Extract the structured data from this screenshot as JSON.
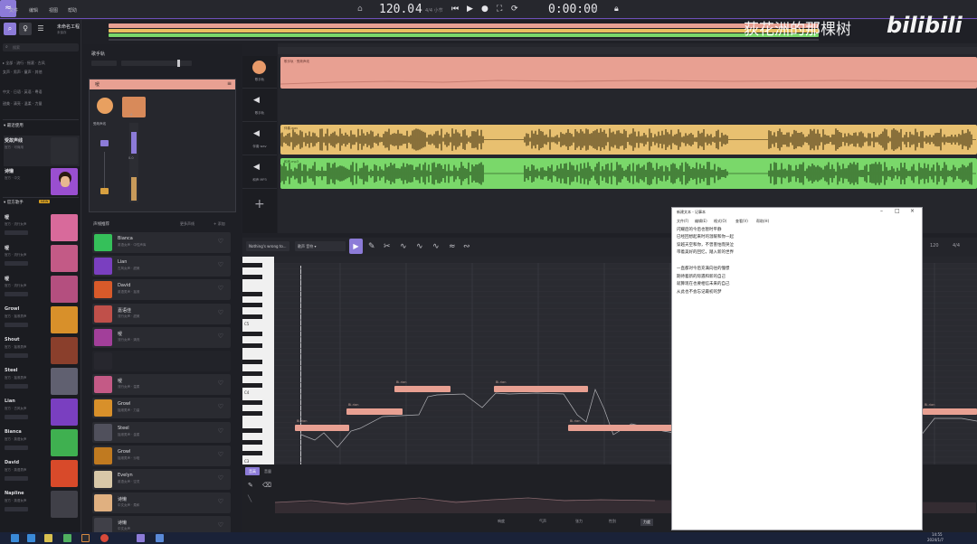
{
  "topbar": {
    "menus": [
      "文件",
      "编辑",
      "视图",
      "帮助"
    ],
    "tempo": "120.0",
    "time_sig_top": "4",
    "time_sig_bottom": "4/4 小节",
    "time": "0:00:00",
    "time_unit": "/ 01"
  },
  "project": {
    "title": "未命名工程",
    "subtitle": "未保存"
  },
  "watermark": {
    "text": "荻花洲的那棵树",
    "logo": "bilibili"
  },
  "sidebar": {
    "search_placeholder": "搜索",
    "rows": [
      "▸ 全部 · 流行 · 摇滚 · 古风",
      "女声 · 男声 · 童声 · 其他",
      "中文 · 日语 · 英语 · 粤语",
      "甜美 · 清亮 · 温柔 · 力量"
    ],
    "section_recent": "▾ 最近使用",
    "section_official": "▾ 官方歌手",
    "badge_new": "NEW",
    "recent": [
      {
        "name": "受故声线",
        "sub": "官方 · 可商用"
      },
      {
        "name": "诗懒",
        "sub": "官方 · 中文"
      }
    ],
    "voices": [
      {
        "name": "嗳",
        "sub": "官方 · 流行女声",
        "color": "#d86a9b"
      },
      {
        "name": "嗳",
        "sub": "官方 · 流行女声",
        "color": "#c35a86"
      },
      {
        "name": "嗳",
        "sub": "官方 · 流行女声",
        "color": "#b44f7f"
      },
      {
        "name": "Growl",
        "sub": "官方 · 摇滚男声",
        "color": "#d8902a"
      },
      {
        "name": "Shout",
        "sub": "官方 · 摇滚男声",
        "color": "#8a3f2c"
      },
      {
        "name": "Steel",
        "sub": "官方 · 摇滚男声",
        "color": "#606070"
      },
      {
        "name": "Lian",
        "sub": "官方 · 古风女声",
        "color": "#7a3fc0"
      },
      {
        "name": "Bianca",
        "sub": "官方 · 英语女声",
        "color": "#3fb050"
      },
      {
        "name": "David",
        "sub": "官方 · 英语男声",
        "color": "#d84a2a"
      },
      {
        "name": "Napline",
        "sub": "官方 · 英语女声",
        "color": "#404048"
      }
    ]
  },
  "mixer": {
    "title": "歌手轨",
    "strip_title": "嗳",
    "strip_label": "受故声线",
    "db_values": [
      "-6",
      "0.0"
    ]
  },
  "voice_list": {
    "title": "声线推荐",
    "link": "更多声线",
    "badge": "+ 添加",
    "items": [
      {
        "name": "Bianca",
        "sub": "英语女声 · 中性声库",
        "color": "#35c05a"
      },
      {
        "name": "Lian",
        "sub": "古风女声 · 甜美",
        "color": "#7a3fc0"
      },
      {
        "name": "David",
        "sub": "英语男声 · 摇滚",
        "color": "#d85a2a"
      },
      {
        "name": "嘉语佳",
        "sub": "流行女声 · 甜美",
        "color": "#c0504a"
      },
      {
        "name": "嗳",
        "sub": "流行女声 · 清亮",
        "color": "#a23f9a"
      },
      {
        "name": "",
        "sub": "",
        "color": "#383840"
      },
      {
        "name": "嗳",
        "sub": "流行女声 · 温柔",
        "color": "#c45a86"
      },
      {
        "name": "Growl",
        "sub": "摇滚男声 · 力量",
        "color": "#d8902a"
      },
      {
        "name": "Steel",
        "sub": "摇滚男声 · 金属",
        "color": "#50505c"
      },
      {
        "name": "Growl",
        "sub": "摇滚男声 · 沙哑",
        "color": "#c07a20"
      },
      {
        "name": "Evelyn",
        "sub": "英语女声 · 空灵",
        "color": "#d8c8a8"
      },
      {
        "name": "诗懒",
        "sub": "中文女声 · 柔和",
        "color": "#e0b080"
      },
      {
        "name": "诗懒",
        "sub": "中文女声",
        "color": "#404048"
      }
    ]
  },
  "tracks": [
    {
      "label": "歌手轨",
      "icon": "avatar"
    },
    {
      "label": "歌手轨",
      "icon": "speaker-icon"
    },
    {
      "label": "伴奏 wav",
      "icon": "speaker-icon"
    },
    {
      "label": "和声 MP3",
      "icon": "speaker-icon"
    }
  ],
  "clips": {
    "vocal": "歌手轨 · 受故声线",
    "wav": "伴奏.wav",
    "mp3": "和声.mp3"
  },
  "piano": {
    "track_name": "Nothing's wrong to...",
    "mode": "歌声 音符 ▾",
    "c5": "C5",
    "c4": "C4",
    "c3": "C3",
    "tempo": "120",
    "sig": "4/4"
  },
  "notes": [
    {
      "lyric": "Bi-rian",
      "color": "#e8a092"
    },
    {
      "lyric": "Bi-rian",
      "color": "#e8a092"
    },
    {
      "lyric": "Bi-rian",
      "color": "#e8a092"
    },
    {
      "lyric": "Bi-rian",
      "color": "#e8a092"
    },
    {
      "lyric": "Bi-rian",
      "color": "#e8a092"
    },
    {
      "lyric": "Bi-rian",
      "color": "#e8a092"
    },
    {
      "lyric": "Bi-rian",
      "color": "#e8a092"
    }
  ],
  "params": {
    "tabs": [
      "音高",
      "音量"
    ],
    "bottom_tabs": [
      "响度",
      "气声",
      "张力",
      "性别",
      "力度"
    ]
  },
  "notepad": {
    "title": "新建文本 - 记事本",
    "menus": [
      "文件(F)",
      "编辑(E)",
      "格式(O)",
      "查看(V)",
      "帮助(H)"
    ],
    "lines": [
      "闪耀后的今后也暂时平静",
      "已经回想起来时的温暖和你一起",
      "穿越天空和你，不曾害怕而哭泣",
      "带着美好的回忆，踏入新的世界",
      "",
      "一直都对今后充满向往的憧憬",
      "期待着新的际遇和新的自己",
      "就算现在也要相信未来的自己",
      "从此也不会忘记最初的梦"
    ]
  },
  "taskbar": {
    "time": "14:55",
    "date": "2024/1/7"
  }
}
